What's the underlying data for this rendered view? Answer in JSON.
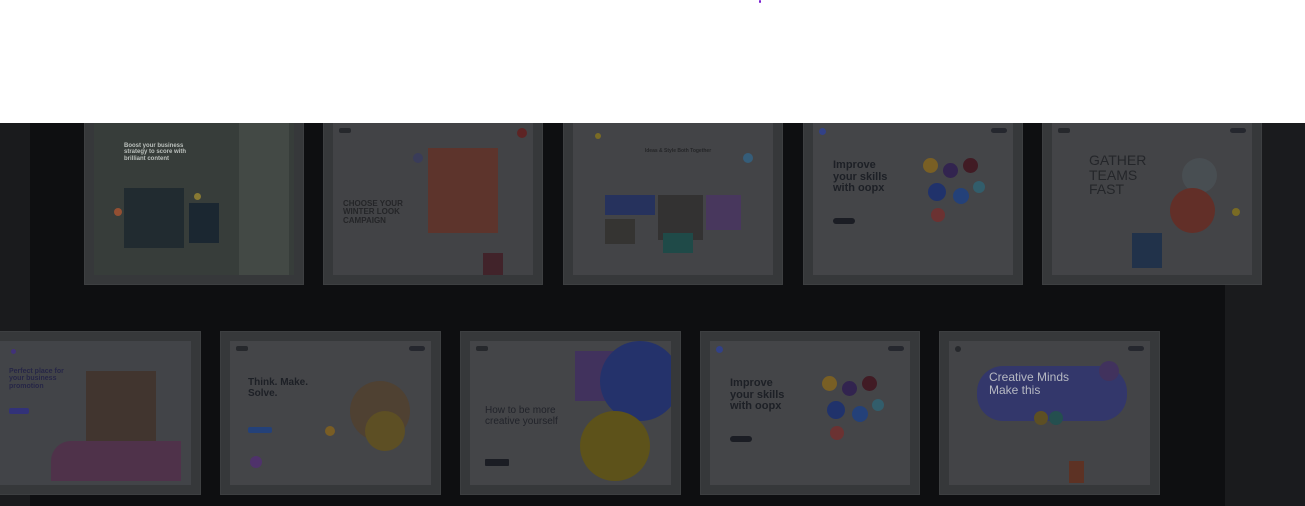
{
  "gallery": {
    "cards": [
      {
        "headline": "Boost your business strategy to score with brilliant content"
      },
      {
        "headline": "CHOOSE YOUR WINTER LOOK CAMPAIGN"
      },
      {
        "headline": "Ideas & Style Both Together"
      },
      {
        "headline": "Improve your skills with oopx"
      },
      {
        "headline": "GATHER TEAMS FAST"
      },
      {
        "headline": "Perfect place for your business promotion"
      },
      {
        "headline": "Think. Make. Solve."
      },
      {
        "headline": "How to be more creative yourself"
      },
      {
        "headline": "Improve your skills with oopx"
      },
      {
        "headline": "Creative Minds Make this"
      }
    ]
  }
}
